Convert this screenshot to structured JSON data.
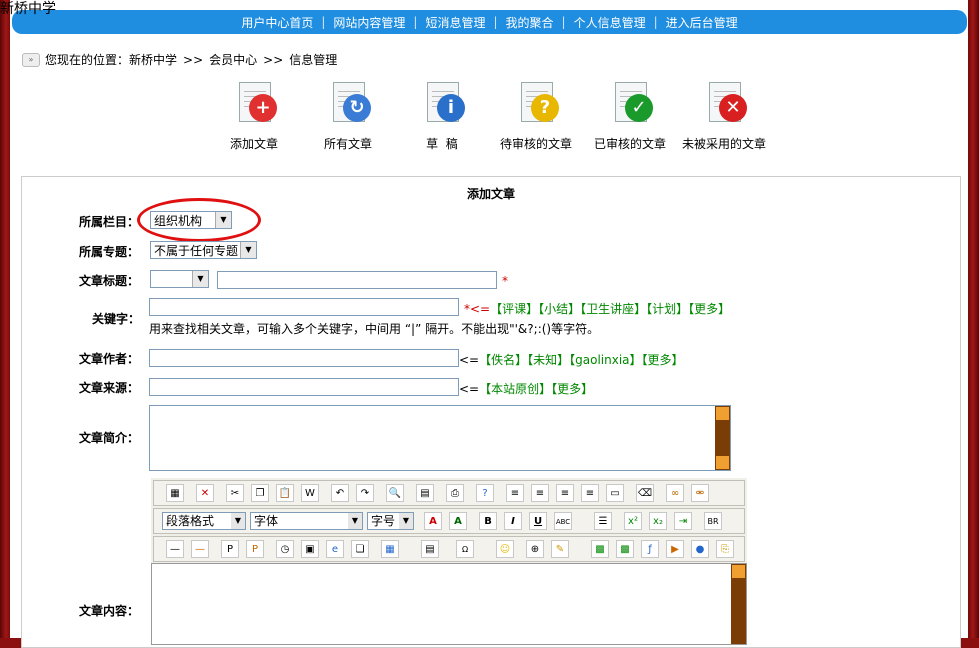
{
  "site_title": "新桥中学",
  "nav": [
    "用户中心首页",
    "网站内容管理",
    "短消息管理",
    "我的聚合",
    "个人信息管理",
    "进入后台管理"
  ],
  "breadcrumb": {
    "prefix": "您现在的位置：",
    "items": [
      "新桥中学",
      "会员中心",
      "信息管理"
    ],
    "sep": ">>"
  },
  "actions": [
    {
      "label": "添加文章",
      "icon": "add-article-icon",
      "color": "#e03030",
      "glyph": "+"
    },
    {
      "label": "所有文章",
      "icon": "all-articles-icon",
      "color": "#3a7bd5",
      "glyph": "↻"
    },
    {
      "label": "草  稿",
      "icon": "draft-icon",
      "color": "#2a6fc9",
      "glyph": "i"
    },
    {
      "label": "待审核的文章",
      "icon": "pending-icon",
      "color": "#e8b800",
      "glyph": "?"
    },
    {
      "label": "已审核的文章",
      "icon": "approved-icon",
      "color": "#1a9a2a",
      "glyph": "✓"
    },
    {
      "label": "未被采用的文章",
      "icon": "rejected-icon",
      "color": "#d82020",
      "glyph": "✕"
    }
  ],
  "form": {
    "title": "添加文章",
    "column_label": "所属栏目：",
    "column_value": "组织机构",
    "topic_label": "所属专题：",
    "topic_value": "不属于任何专题",
    "title_label": "文章标题：",
    "title_prefix_value": "",
    "title_value": "",
    "required_mark": "*",
    "keyword_label": "关键字：",
    "keyword_value": "",
    "keyword_hint_prefix": "*<=",
    "keyword_options": [
      "【评课】",
      "【小结】",
      "【卫生讲座】",
      "【计划】",
      "【更多】"
    ],
    "keyword_help": "用来查找相关文章，可输入多个关键字，中间用 “|” 隔开。不能出现\"'&?;:()等字符。",
    "author_label": "文章作者：",
    "author_value": "",
    "author_hint_prefix": "<=",
    "author_options": [
      "【佚名】",
      "【未知】",
      "【gaolinxia】",
      "【更多】"
    ],
    "source_label": "文章来源：",
    "source_value": "",
    "source_hint_prefix": "<=",
    "source_options": [
      "【本站原创】",
      "【更多】"
    ],
    "summary_label": "文章简介：",
    "content_label": "文章内容："
  },
  "editor": {
    "paragraph_format": "段落格式",
    "font_family": "字体",
    "font_size": "字号"
  }
}
